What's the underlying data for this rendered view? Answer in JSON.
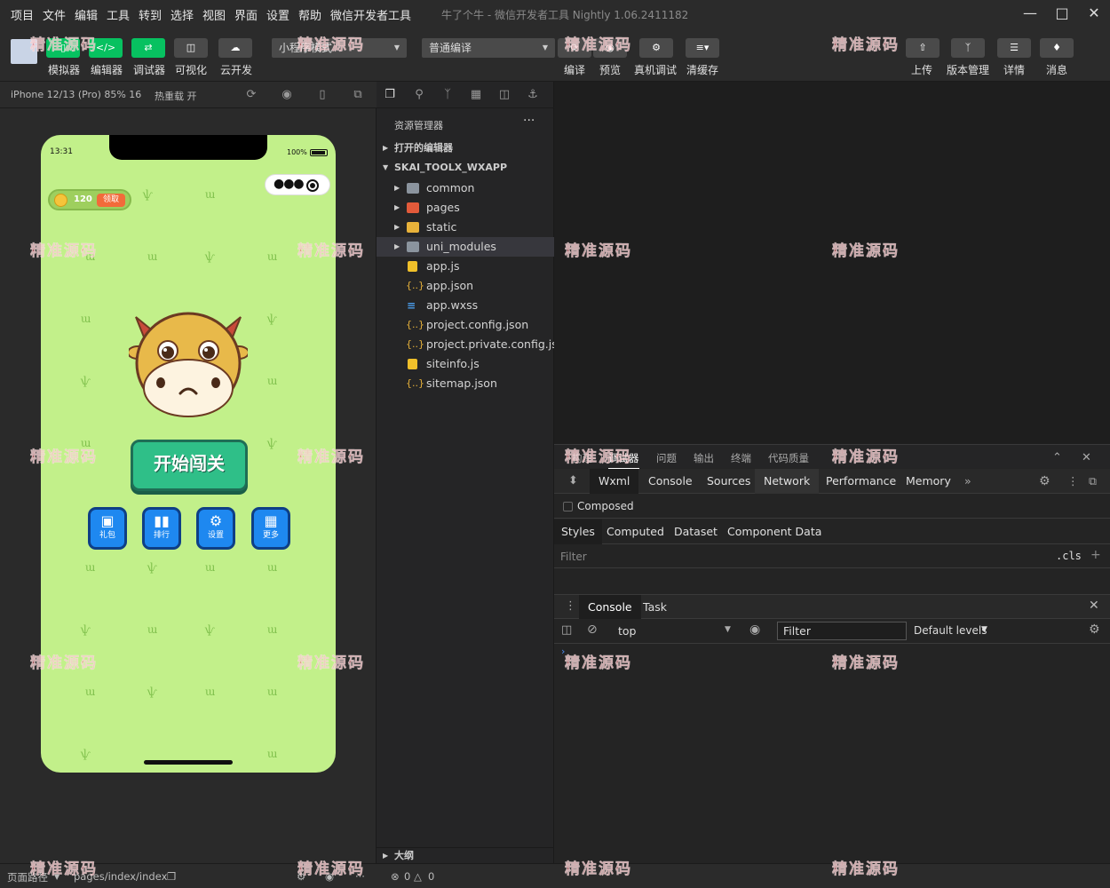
{
  "menu": [
    "项目",
    "文件",
    "编辑",
    "工具",
    "转到",
    "选择",
    "视图",
    "界面",
    "设置",
    "帮助",
    "微信开发者工具"
  ],
  "app_title": "牛了个牛 - 微信开发者工具 Nightly 1.06.2411182",
  "toolbar": {
    "left_labels": [
      "模拟器",
      "编辑器",
      "调试器",
      "可视化",
      "云开发"
    ],
    "mode_select": "小程序模式",
    "compile_select": "普通编译",
    "mid_labels": [
      "编译",
      "预览",
      "真机调试",
      "清缓存"
    ],
    "right_labels": [
      "上传",
      "版本管理",
      "详情",
      "消息"
    ]
  },
  "simulator": {
    "device": "iPhone 12/13 (Pro) 85% 16",
    "hot_reload": "热重载 开",
    "phone": {
      "time": "13:31",
      "battery": "100%",
      "coins": "120",
      "claim": "领取",
      "start_button": "开始闯关",
      "buttons": [
        {
          "label": "礼包",
          "icon": "gift-icon"
        },
        {
          "label": "排行",
          "icon": "bar-chart-icon"
        },
        {
          "label": "设置",
          "icon": "gear-icon"
        },
        {
          "label": "更多",
          "icon": "grid-icon"
        }
      ]
    }
  },
  "explorer": {
    "title": "资源管理器",
    "open_editors": "打开的编辑器",
    "project": "SKAI_TOOLX_WXAPP",
    "items": [
      {
        "name": "common",
        "type": "folder"
      },
      {
        "name": "pages",
        "type": "folder-red"
      },
      {
        "name": "static",
        "type": "folder-yel"
      },
      {
        "name": "uni_modules",
        "type": "folder"
      },
      {
        "name": "app.js",
        "type": "js"
      },
      {
        "name": "app.json",
        "type": "json"
      },
      {
        "name": "app.wxss",
        "type": "css"
      },
      {
        "name": "project.config.json",
        "type": "json"
      },
      {
        "name": "project.private.config.js...",
        "type": "json"
      },
      {
        "name": "siteinfo.js",
        "type": "js"
      },
      {
        "name": "sitemap.json",
        "type": "json"
      }
    ],
    "outline": "大纲"
  },
  "debug": {
    "tabs": [
      "构建",
      "调试器",
      "问题",
      "输出",
      "终端",
      "代码质量"
    ],
    "devtools_tabs": [
      "Wxml",
      "Console",
      "Sources",
      "Network",
      "Performance",
      "Memory"
    ],
    "composed": "Composed",
    "style_tabs": [
      "Styles",
      "Computed",
      "Dataset",
      "Component Data"
    ],
    "filter_placeholder": "Filter",
    "cls": ".cls",
    "console_tabs": [
      "Console",
      "Task"
    ],
    "context": "top",
    "filter2": "Filter",
    "levels": "Default levels"
  },
  "status": {
    "page_path_label": "页面路径",
    "page_path": "pages/index/index",
    "errors": "0",
    "warnings": "0"
  },
  "watermark": "精准源码"
}
